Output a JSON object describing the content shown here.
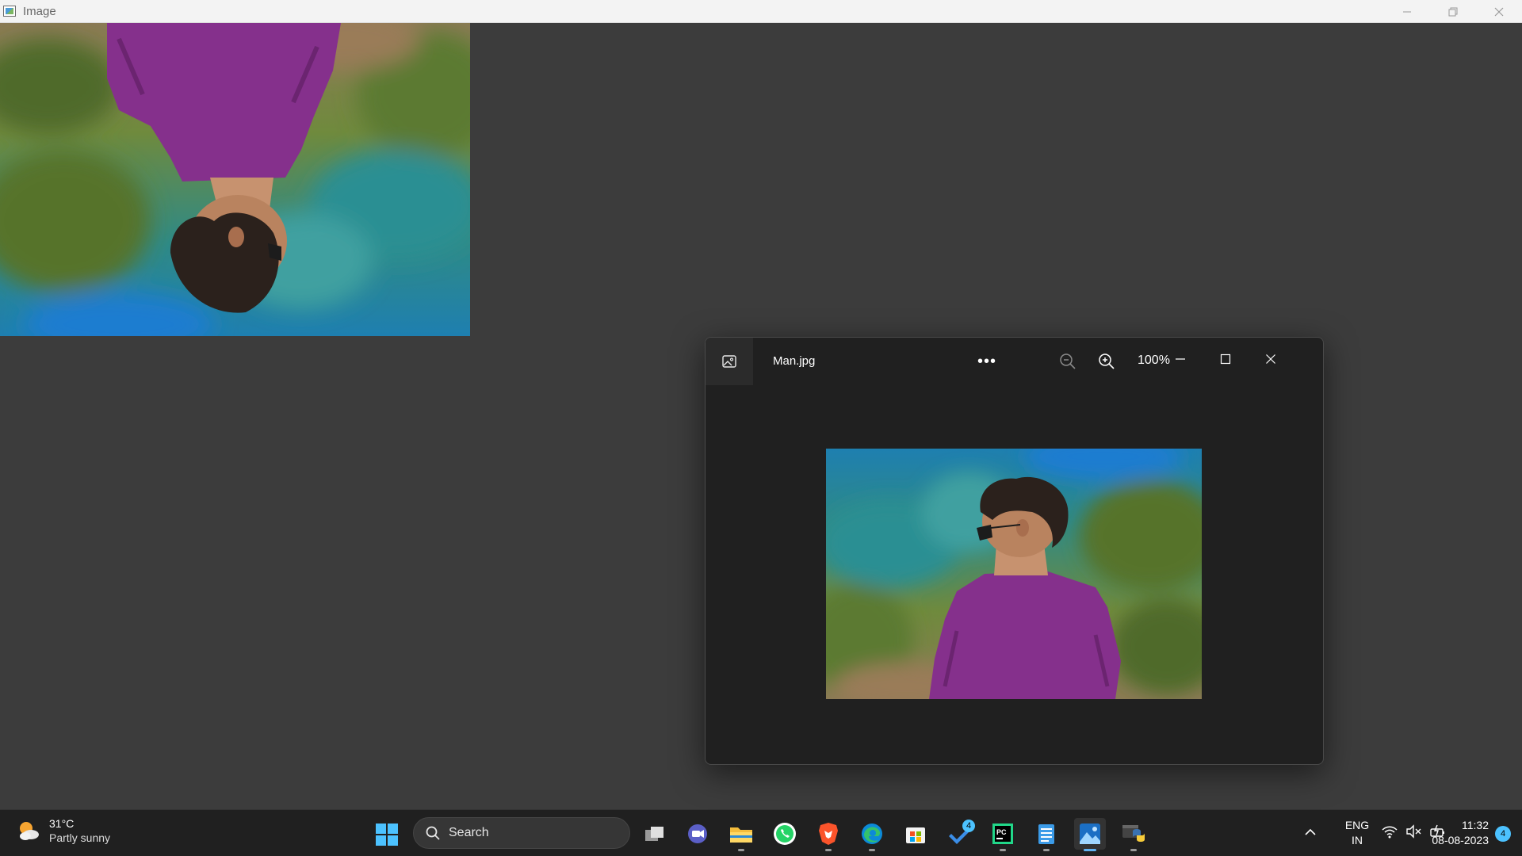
{
  "main_window": {
    "title": "Image",
    "icon": "image-app-icon",
    "controls": {
      "minimize_icon": "minimize-icon",
      "restore_icon": "restore-icon",
      "close_icon": "close-icon"
    }
  },
  "photos_viewer": {
    "filename": "Man.jpg",
    "zoom_level": "100%",
    "more_label": "•••",
    "icons": [
      "gallery-icon",
      "more-options-icon",
      "zoom-out-icon",
      "zoom-in-icon",
      "minimize-icon",
      "maximize-icon",
      "close-icon"
    ]
  },
  "taskbar": {
    "weather": {
      "temp": "31°C",
      "condition": "Partly sunny",
      "icon": "partly-sunny-icon"
    },
    "search_label": "Search",
    "apps": [
      {
        "name": "task-view",
        "icon": "task-view-icon"
      },
      {
        "name": "teams-meet",
        "icon": "teams-meet-icon"
      },
      {
        "name": "file-explorer",
        "icon": "folder-icon"
      },
      {
        "name": "whatsapp",
        "icon": "whatsapp-icon"
      },
      {
        "name": "brave",
        "icon": "brave-icon"
      },
      {
        "name": "edge",
        "icon": "edge-icon"
      },
      {
        "name": "microsoft-store",
        "icon": "store-icon"
      },
      {
        "name": "todo",
        "icon": "todo-icon",
        "badge": "4"
      },
      {
        "name": "pycharm",
        "icon": "pycharm-icon"
      },
      {
        "name": "notepad",
        "icon": "notepad-icon"
      },
      {
        "name": "photos",
        "icon": "photos-icon"
      },
      {
        "name": "python",
        "icon": "python-icon"
      }
    ],
    "tray": {
      "lang_line1": "ENG",
      "lang_line2": "IN",
      "time": "11:32",
      "date": "08-08-2023",
      "notification_count": "4"
    }
  },
  "colors": {
    "desktop_bg": "#3c3c3c",
    "viewer_bg": "#202020",
    "taskbar_bg": "#202020",
    "accent": "#4cc2ff",
    "shirt": "#8a2f8f"
  }
}
